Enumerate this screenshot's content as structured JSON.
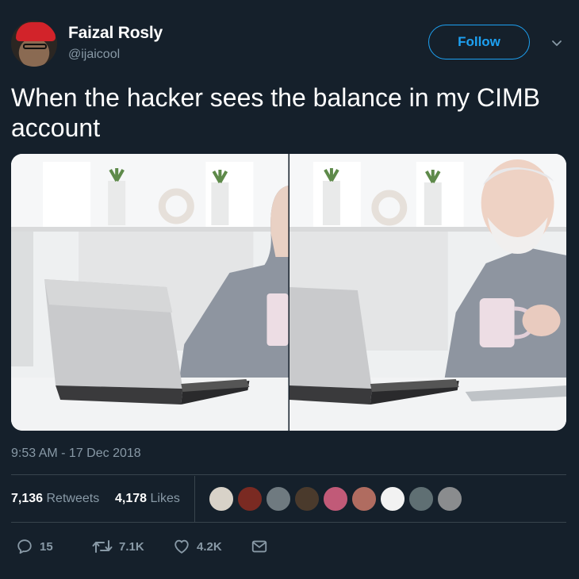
{
  "user": {
    "name": "Faizal Rosly",
    "handle": "@ijaicool"
  },
  "header": {
    "follow_label": "Follow"
  },
  "tweet": {
    "text": "When the hacker sees the balance in my CIMB account",
    "timestamp": "9:53 AM - 17 Dec 2018"
  },
  "stats": {
    "retweets_count": "7,136",
    "retweets_label": "Retweets",
    "likes_count": "4,178",
    "likes_label": "Likes"
  },
  "actions": {
    "replies": "15",
    "retweets": "7.1K",
    "likes": "4.2K"
  },
  "colors": {
    "background": "#15202b",
    "accent": "#1da1f2",
    "muted": "#8899a6",
    "divider": "#38444d"
  },
  "icons": [
    "reply-icon",
    "retweet-icon",
    "like-icon",
    "message-icon",
    "chevron-down-icon"
  ]
}
